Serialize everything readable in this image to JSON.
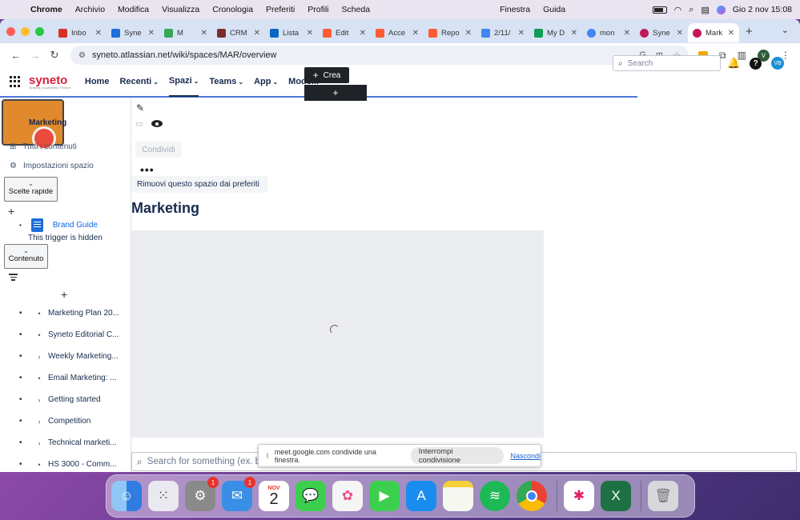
{
  "menubar": {
    "app": "Chrome",
    "items": [
      "Archivio",
      "Modifica",
      "Visualizza",
      "Cronologia",
      "Preferiti",
      "Profili",
      "Scheda"
    ],
    "extra": [
      "Finestra",
      "Guida"
    ],
    "clock": "Gio 2 nov  15:08"
  },
  "tabs": [
    {
      "title": "Inbo",
      "color": "#d93025"
    },
    {
      "title": "Syne",
      "color": "#1d6ed8"
    },
    {
      "title": "M",
      "color": "#34a853"
    },
    {
      "title": "CRM",
      "color": "#7b2d2d"
    },
    {
      "title": "Lista",
      "color": "#0a66c2"
    },
    {
      "title": "Edit",
      "color": "#ff5c35"
    },
    {
      "title": "Acce",
      "color": "#ff5c35"
    },
    {
      "title": "Repo",
      "color": "#ff5c35"
    },
    {
      "title": "2/11/",
      "color": "#4285f4"
    },
    {
      "title": "My D",
      "color": "#0f9d58"
    },
    {
      "title": "mon",
      "color": "#4285f4"
    },
    {
      "title": "Syne",
      "color": "#c2185b"
    },
    {
      "title": "Mark",
      "color": "#c2185b"
    }
  ],
  "toolbar": {
    "url": "syneto.atlassian.net/wiki/spaces/MAR/overview",
    "profile_initial": "V"
  },
  "confnav": {
    "logo": "syneto",
    "logo_tag": "Simplify | Accelerate | Protect",
    "items": [
      "Home",
      "Recenti",
      "Spazi",
      "Teams",
      "App",
      "Modelli"
    ],
    "crea_label": "Crea",
    "search_placeholder": "Search",
    "user_initials": "VB"
  },
  "sidebar": {
    "space_name": "Marketing",
    "all_content": "Tutti i contenuti",
    "settings": "Impostazioni spazio",
    "shortcuts_label": "Scelte rapide",
    "shortcut_item": "Brand Guide",
    "hidden_note": "This trigger is hidden",
    "content_label": "Contenuto",
    "tree": [
      {
        "label": "Marketing Plan 20...",
        "arrow": "•"
      },
      {
        "label": "Syneto Editorial C...",
        "arrow": "•"
      },
      {
        "label": "Weekly Marketing...",
        "arrow": "›"
      },
      {
        "label": "Email Marketing: ...",
        "arrow": "•"
      },
      {
        "label": "Getting started",
        "arrow": "›"
      },
      {
        "label": "Competition",
        "arrow": "›"
      },
      {
        "label": "Technical marketi...",
        "arrow": "›"
      },
      {
        "label": "HS 3000 - Comm...",
        "arrow": "•"
      }
    ]
  },
  "main": {
    "share_label": "Condividi",
    "unfavorite_label": "Rimuovi questo spazio dai preferiti",
    "title": "Marketing",
    "bottom_search_placeholder": "Search for something (ex. b"
  },
  "sharebar": {
    "message": "meet.google.com condivide una finestra.",
    "stop_label": "Interrompi condivisione",
    "hide_label": "Nascondi"
  },
  "dock": {
    "apps": [
      {
        "name": "finder-icon",
        "color": "#3a8ee6"
      },
      {
        "name": "launchpad-icon",
        "color": "#e9e9ef"
      },
      {
        "name": "system-settings-icon",
        "color": "#8a8a8a",
        "badge": "1"
      },
      {
        "name": "mail-icon",
        "color": "#3a8ee6",
        "badge": "1"
      },
      {
        "name": "calendar-icon",
        "color": "#ffffff",
        "month": "NOV",
        "day": "2"
      },
      {
        "name": "messages-icon",
        "color": "#3ccf4e"
      },
      {
        "name": "photos-icon",
        "color": "#f5f5f5"
      },
      {
        "name": "facetime-icon",
        "color": "#3ccf4e"
      },
      {
        "name": "app-store-icon",
        "color": "#1a8cf0"
      },
      {
        "name": "notes-icon",
        "color": "#f7f7f2"
      },
      {
        "name": "spotify-icon",
        "color": "#1db954"
      },
      {
        "name": "chrome-icon",
        "color": "#f4f4f4"
      },
      {
        "name": "slack-icon",
        "color": "#ffffff"
      },
      {
        "name": "excel-icon",
        "color": "#1e7145"
      },
      {
        "name": "trash-icon",
        "color": "#d8d8dc"
      }
    ]
  }
}
